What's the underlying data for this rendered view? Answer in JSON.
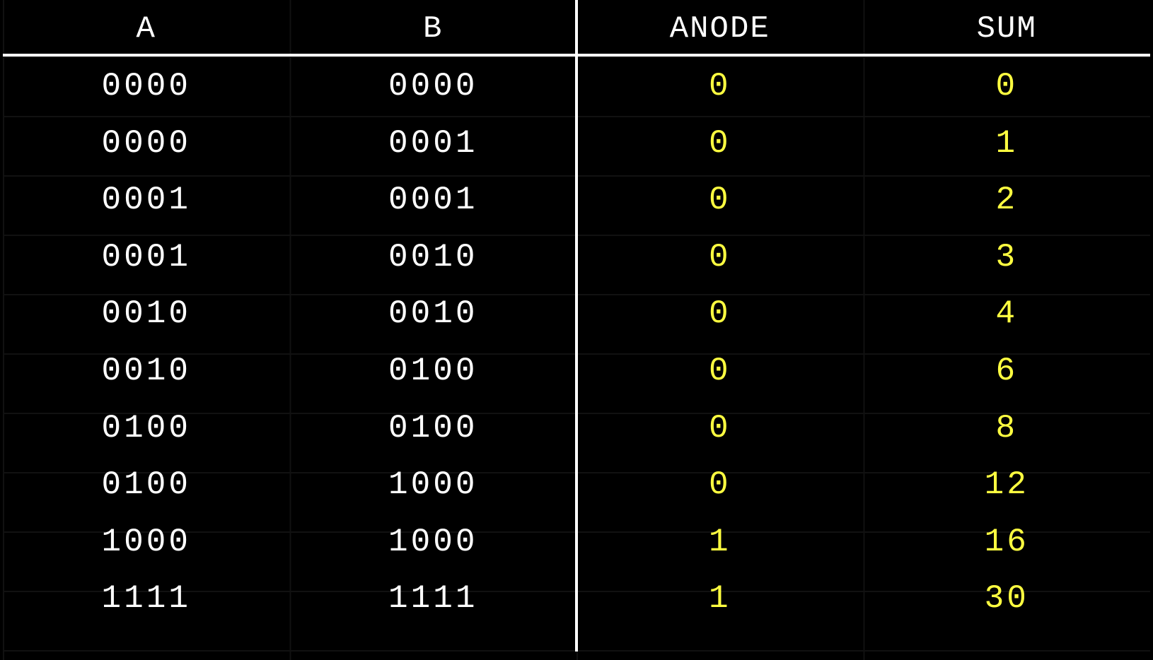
{
  "headers": [
    "A",
    "B",
    "ANODE",
    "SUM"
  ],
  "colors": {
    "background": "#000000",
    "input_text": "#ffffff",
    "output_text": "#ffff40",
    "rule": "#ffffff"
  },
  "rows": [
    [
      "0000",
      "0000",
      "0",
      "0"
    ],
    [
      "0000",
      "0001",
      "0",
      "1"
    ],
    [
      "0001",
      "0001",
      "0",
      "2"
    ],
    [
      "0001",
      "0010",
      "0",
      "3"
    ],
    [
      "0010",
      "0010",
      "0",
      "4"
    ],
    [
      "0010",
      "0100",
      "0",
      "6"
    ],
    [
      "0100",
      "0100",
      "0",
      "8"
    ],
    [
      "0100",
      "1000",
      "0",
      "12"
    ],
    [
      "1000",
      "1000",
      "1",
      "16"
    ],
    [
      "1111",
      "1111",
      "1",
      "30"
    ]
  ]
}
